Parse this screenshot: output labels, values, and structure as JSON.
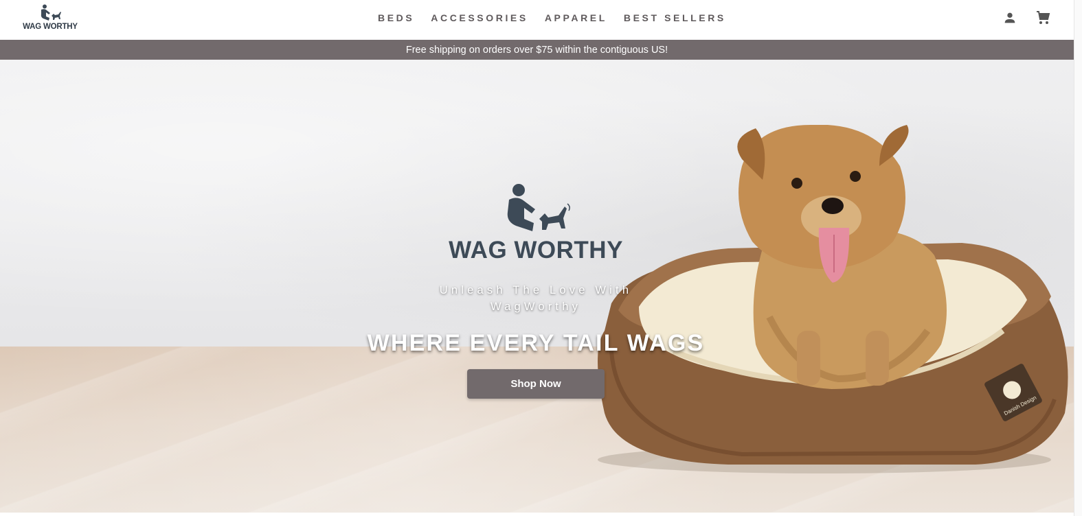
{
  "header": {
    "logo_text": "WAG WORTHY",
    "nav": [
      {
        "label": "BEDS"
      },
      {
        "label": "ACCESSORIES"
      },
      {
        "label": "APPAREL"
      },
      {
        "label": "BEST SELLERS"
      }
    ],
    "icons": [
      "account-icon",
      "cart-icon"
    ]
  },
  "announcement": {
    "text": "Free shipping on orders over $75 within the contiguous US!"
  },
  "hero": {
    "logo_text": "WAG WORTHY",
    "tagline": "Unleash The Love With WagWorthy",
    "headline": "WHERE EVERY TAIL WAGS",
    "cta_label": "Shop Now",
    "image_subject": "dog-in-bed-photo",
    "bed_badge_text": "Danish Design"
  },
  "colors": {
    "brand_gray": "#726a6c",
    "logo_navy": "#3d4a57",
    "nav_text": "#5f5a5c"
  }
}
